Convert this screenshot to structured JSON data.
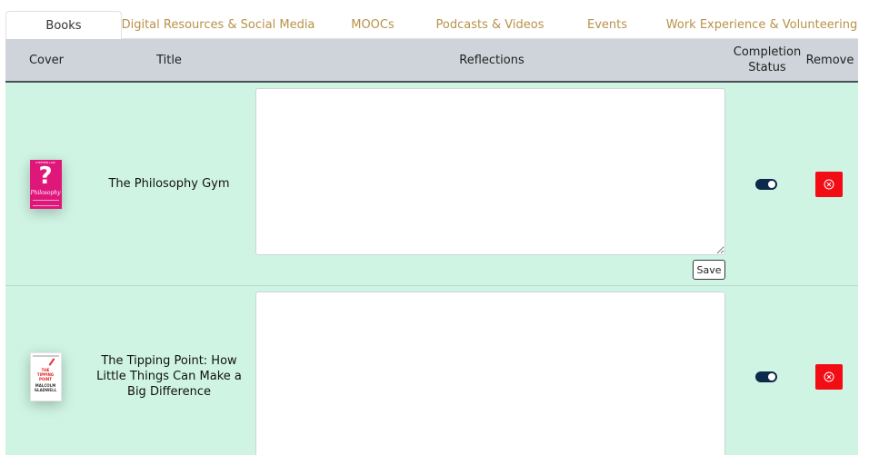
{
  "tabs": [
    {
      "label": "Books",
      "active": true
    },
    {
      "label": "Digital Resources & Social Media",
      "active": false
    },
    {
      "label": "MOOCs",
      "active": false
    },
    {
      "label": "Podcasts & Videos",
      "active": false
    },
    {
      "label": "Events",
      "active": false
    },
    {
      "label": "Work Experience & Volunteering",
      "active": false
    }
  ],
  "table": {
    "headers": {
      "cover": "Cover",
      "title": "Title",
      "reflections": "Reflections",
      "status_line1": "Completion",
      "status_line2": "Status",
      "remove": "Remove"
    },
    "rows": [
      {
        "title": "The Philosophy Gym",
        "reflection": "",
        "completed": true,
        "save_label": "Save",
        "cover": {
          "author": "STEPHEN LAW",
          "mark": "?",
          "word": "Philosophy"
        }
      },
      {
        "title": "The Tipping Point: How Little Things Can Make a Big Difference",
        "reflection": "",
        "completed": true,
        "cover": {
          "line1": "THE",
          "line2": "TIPPING",
          "line3": "POINT",
          "author1": "MALCOLM",
          "author2": "GLADWELL"
        }
      }
    ]
  },
  "colors": {
    "tab_text": "#b8924a",
    "header_bg": "#ced4da",
    "row_bg": "#cff4e4",
    "toggle_on": "#0d2a4d",
    "remove_bg": "#f20c14"
  },
  "icons": {
    "remove": "circle-x-icon",
    "status": "toggle-switch"
  }
}
